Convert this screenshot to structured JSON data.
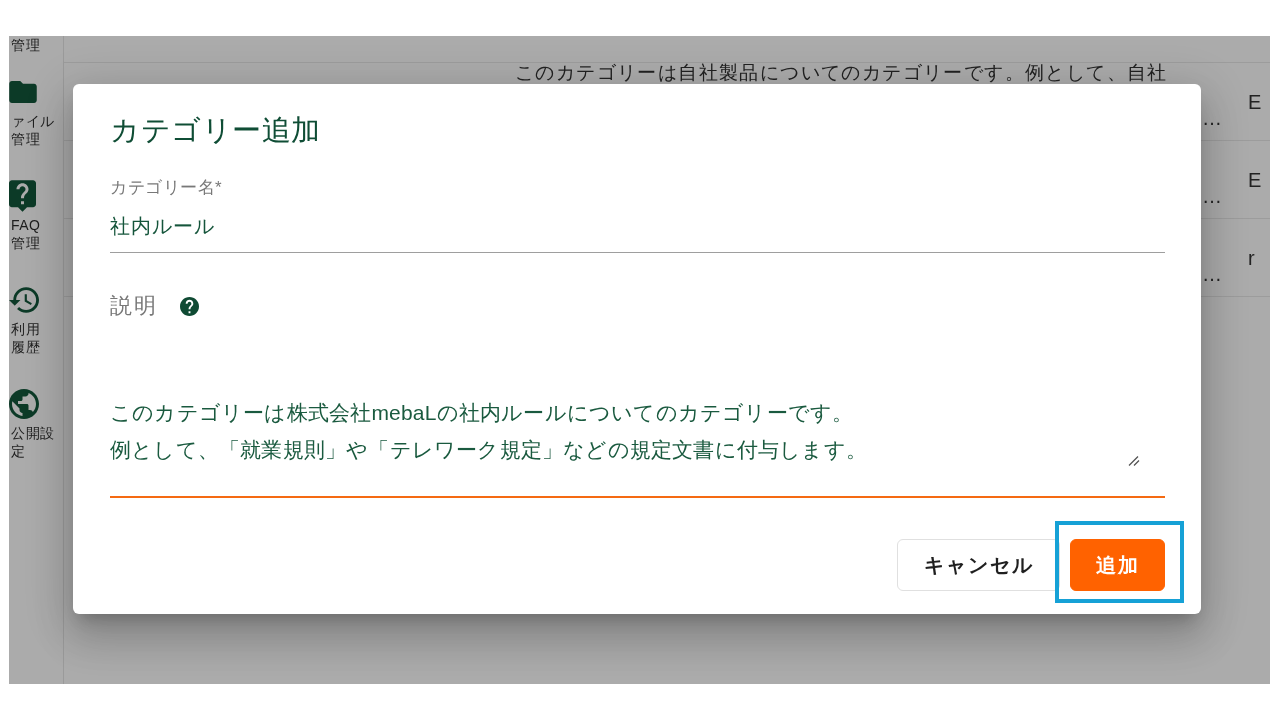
{
  "sidebar": {
    "items": [
      {
        "lines": [
          "管理"
        ]
      },
      {
        "lines": [
          "ァイル",
          "管理"
        ]
      },
      {
        "lines": [
          "FAQ",
          "管理"
        ]
      },
      {
        "lines": [
          "利用",
          "履歴"
        ]
      },
      {
        "lines": [
          "公開設",
          "定"
        ]
      }
    ]
  },
  "table": {
    "rows": [
      {
        "description_top": "このカテゴリーは自社製品についてのカテゴリーです。例として、自社",
        "description_end": "…",
        "column_3": "E"
      },
      {
        "description_end": "…",
        "column_3": "E"
      },
      {
        "description_end": "…",
        "column_3": "r"
      }
    ]
  },
  "dialog": {
    "title": "カテゴリー追加",
    "fields": [
      {
        "kind": "text",
        "label": "カテゴリー名*",
        "value": "社内ルール",
        "focused": false
      },
      {
        "kind": "textarea",
        "label": "説明",
        "lines": [
          "このカテゴリーは株式会社mebaLの社内ルールについてのカテゴリーです。",
          "例として、「就業規則」や「テレワーク規定」などの規定文書に付与します。"
        ],
        "focused": true,
        "help": true
      }
    ],
    "buttons": [
      {
        "label": "キャンセル",
        "kind": "secondary",
        "highlighted": false
      },
      {
        "label": "追加",
        "kind": "primary",
        "highlighted": true
      }
    ]
  }
}
